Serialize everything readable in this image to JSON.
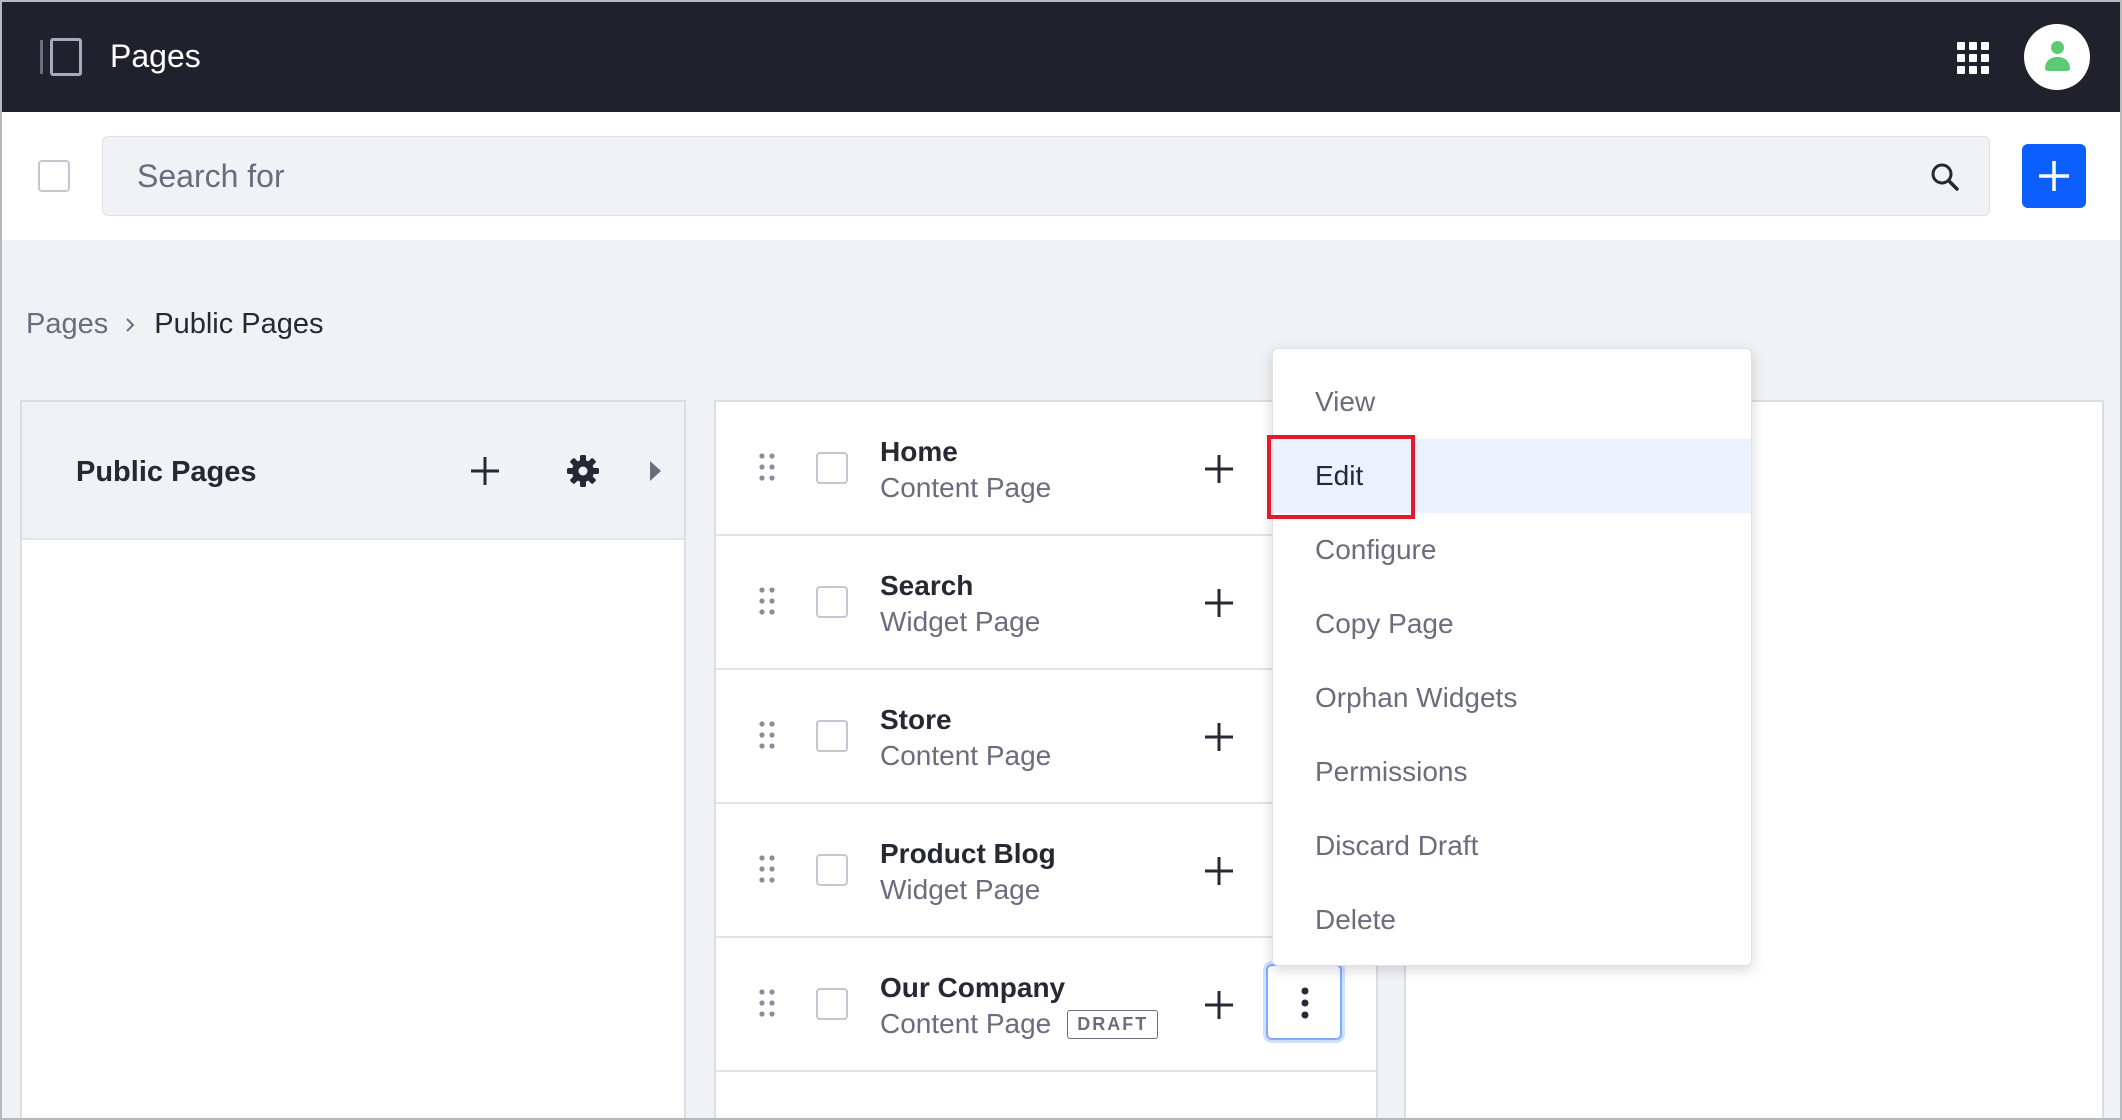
{
  "header": {
    "title": "Pages",
    "apps_icon": "apps-grid-icon",
    "avatar_icon": "user-avatar-icon"
  },
  "search": {
    "placeholder": "Search for",
    "value": ""
  },
  "breadcrumb": {
    "items": [
      "Pages",
      "Public Pages"
    ]
  },
  "tree": {
    "title": "Public Pages"
  },
  "pages": [
    {
      "title": "Home",
      "type": "Content Page",
      "badge": ""
    },
    {
      "title": "Search",
      "type": "Widget Page",
      "badge": ""
    },
    {
      "title": "Store",
      "type": "Content Page",
      "badge": ""
    },
    {
      "title": "Product Blog",
      "type": "Widget Page",
      "badge": ""
    },
    {
      "title": "Our Company",
      "type": "Content Page",
      "badge": "DRAFT"
    }
  ],
  "menu": {
    "items": [
      "View",
      "Edit",
      "Configure",
      "Copy Page",
      "Orphan Widgets",
      "Permissions",
      "Discard Draft",
      "Delete"
    ],
    "active": "Edit"
  },
  "colors": {
    "accent": "#0b5fff",
    "topbar": "#20212d",
    "highlight": "#e3192d",
    "avatar": "#5aca75"
  }
}
